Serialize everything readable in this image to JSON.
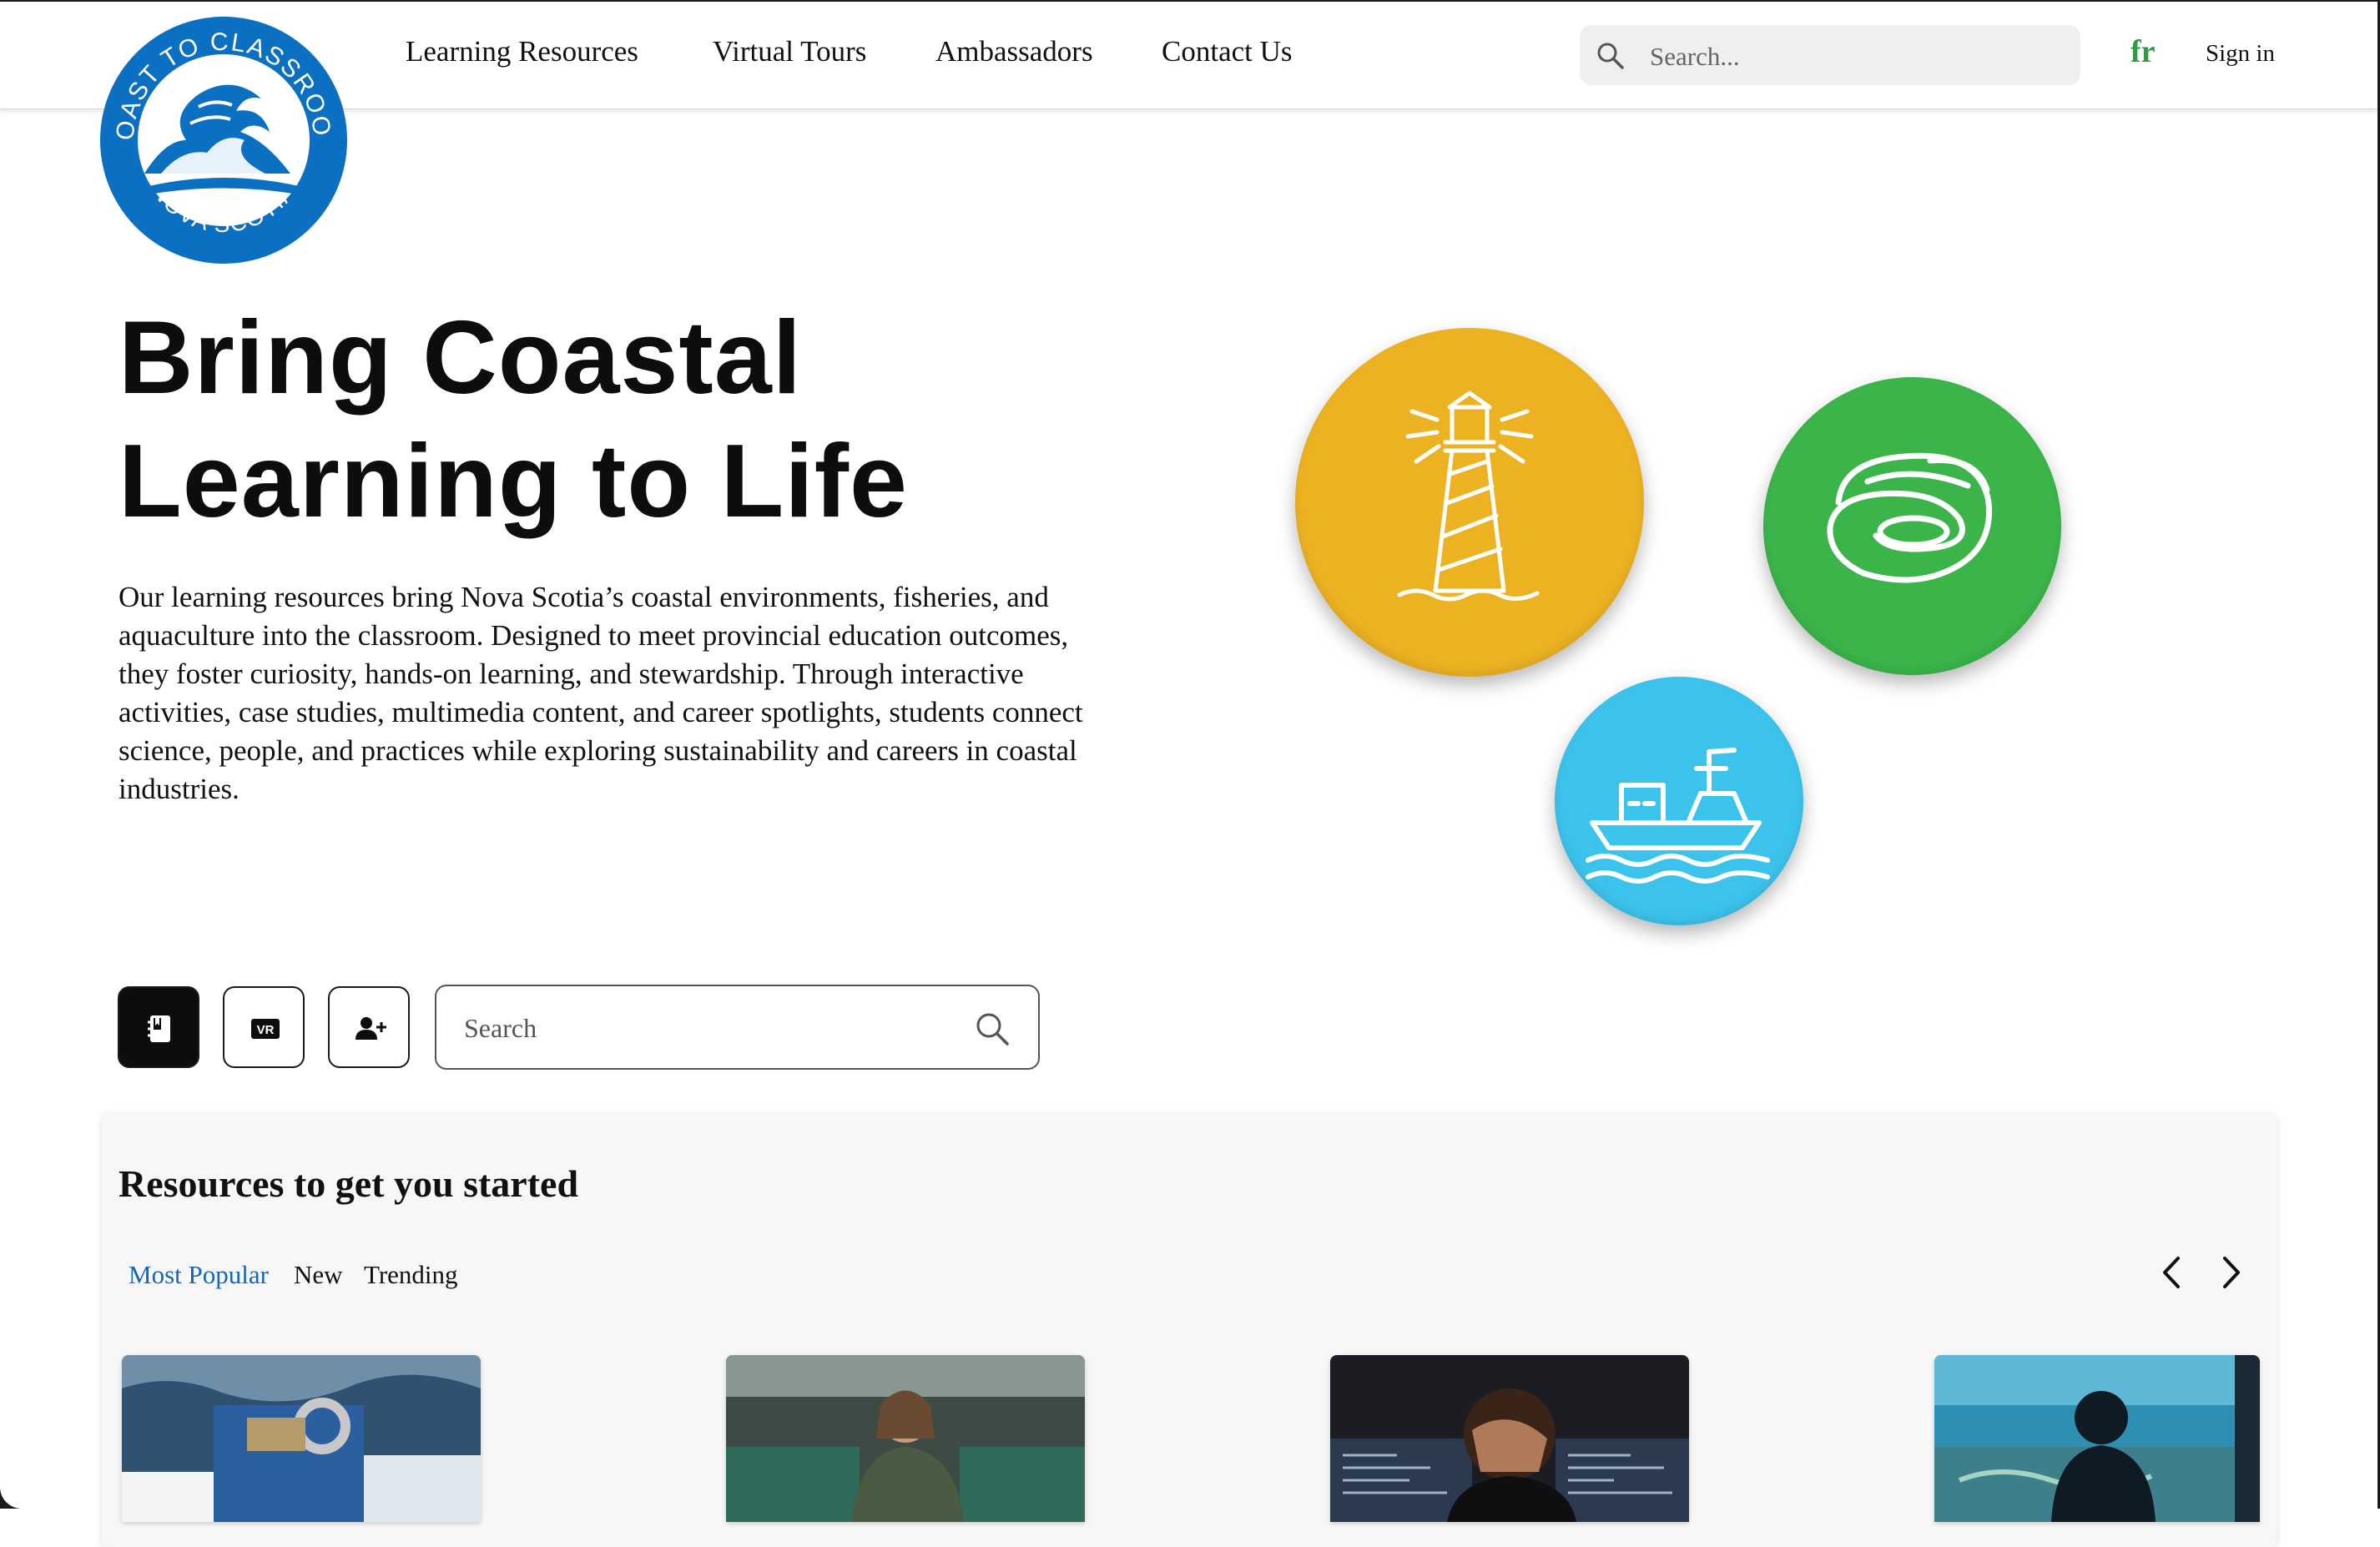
{
  "brand": {
    "logo_top_text": "COAST TO CLASSROOM",
    "logo_bottom_text": "NOVA SCOTIA",
    "logo_color": "#0b6fc2"
  },
  "nav": {
    "items": [
      "Learning Resources",
      "Virtual Tours",
      "Ambassadors",
      "Contact Us"
    ],
    "search_placeholder": "Search...",
    "language_toggle": "fr",
    "sign_in": "Sign in"
  },
  "hero": {
    "title_line1": "Bring Coastal",
    "title_line2": "Learning to Life",
    "description": "Our learning resources bring Nova Scotia’s coastal environments, fisheries, and aquaculture into the classroom. Designed to meet provincial education outcomes, they foster curiosity, hands-on learning, and stewardship. Through interactive activities, case studies, multimedia content, and career spotlights, students connect science, people, and practices while exploring sustainability and careers in coastal industries.",
    "bubbles": [
      {
        "icon": "lighthouse-icon",
        "color": "#ecb222"
      },
      {
        "icon": "oyster-icon",
        "color": "#3bb54a"
      },
      {
        "icon": "fishing-boat-icon",
        "color": "#3cc3ec"
      }
    ]
  },
  "filters": {
    "buttons": [
      {
        "icon": "notebook-icon",
        "active": true
      },
      {
        "icon": "vr-icon",
        "label": "VR",
        "active": false
      },
      {
        "icon": "add-user-icon",
        "active": false
      }
    ],
    "search_placeholder": "Search"
  },
  "resources": {
    "title": "Resources to get you started",
    "tabs": [
      "Most Popular",
      "New",
      "Trending"
    ],
    "active_tab": "Most Popular",
    "cards": [
      {
        "image": "fishing-vessel-deck-photo"
      },
      {
        "image": "aquaculture-worker-photo"
      },
      {
        "image": "computer-monitors-photo"
      },
      {
        "image": "underwater-screen-silhouette-photo"
      }
    ]
  },
  "colors": {
    "accent_link": "#1565b8",
    "language_green": "#2e9b42"
  }
}
